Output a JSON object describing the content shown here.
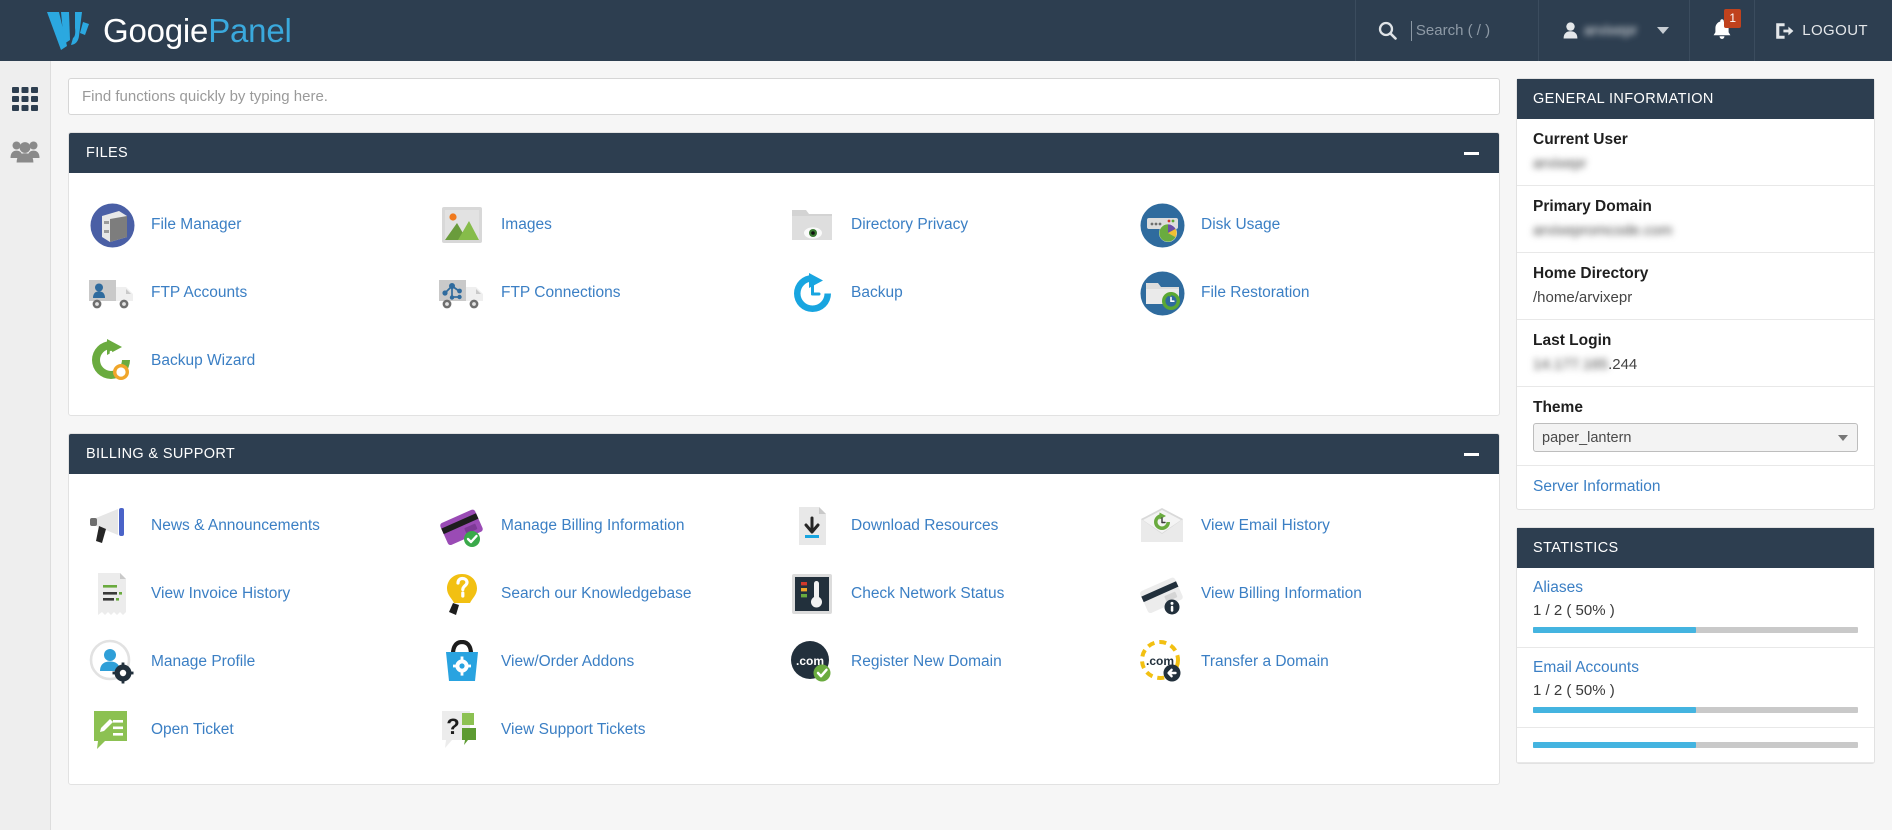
{
  "header": {
    "brand_primary": "Googie",
    "brand_secondary": "Panel",
    "search_placeholder": "Search ( / )",
    "search_value": "",
    "username": "arvixepr",
    "notification_count": "1",
    "logout_label": "LOGOUT",
    "bg_color": "#2d3e50"
  },
  "rail": {
    "items": [
      {
        "name": "apps-grid",
        "label": "Home"
      },
      {
        "name": "user-group",
        "label": "User Manager"
      }
    ]
  },
  "quick_search": {
    "placeholder": "Find functions quickly by typing here.",
    "value": ""
  },
  "panels": [
    {
      "id": "files",
      "title": "FILES",
      "collapse_label": "−",
      "items": [
        {
          "label": "File Manager",
          "icon": "file-manager-icon"
        },
        {
          "label": "Images",
          "icon": "images-icon"
        },
        {
          "label": "Directory Privacy",
          "icon": "directory-privacy-icon"
        },
        {
          "label": "Disk Usage",
          "icon": "disk-usage-icon"
        },
        {
          "label": "FTP Accounts",
          "icon": "ftp-accounts-icon"
        },
        {
          "label": "FTP Connections",
          "icon": "ftp-connections-icon"
        },
        {
          "label": "Backup",
          "icon": "backup-icon"
        },
        {
          "label": "File Restoration",
          "icon": "file-restoration-icon"
        },
        {
          "label": "Backup Wizard",
          "icon": "backup-wizard-icon"
        }
      ]
    },
    {
      "id": "billing-support",
      "title": "BILLING & SUPPORT",
      "collapse_label": "−",
      "items": [
        {
          "label": "News & Announcements",
          "icon": "megaphone-icon"
        },
        {
          "label": "Manage Billing Information",
          "icon": "credit-card-check-icon"
        },
        {
          "label": "Download Resources",
          "icon": "download-file-icon"
        },
        {
          "label": "View Email History",
          "icon": "email-history-icon"
        },
        {
          "label": "View Invoice History",
          "icon": "invoice-icon"
        },
        {
          "label": "Search our Knowledgebase",
          "icon": "lightbulb-question-icon"
        },
        {
          "label": "Check Network Status",
          "icon": "thermometer-icon"
        },
        {
          "label": "View Billing Information",
          "icon": "credit-card-info-icon"
        },
        {
          "label": "Manage Profile",
          "icon": "profile-gear-icon"
        },
        {
          "label": "View/Order Addons",
          "icon": "shopping-bag-gear-icon"
        },
        {
          "label": "Register New Domain",
          "icon": "domain-register-icon"
        },
        {
          "label": "Transfer a Domain",
          "icon": "domain-transfer-icon"
        },
        {
          "label": "Open Ticket",
          "icon": "open-ticket-icon"
        },
        {
          "label": "View Support Tickets",
          "icon": "support-tickets-icon"
        }
      ]
    }
  ],
  "general_information": {
    "title": "GENERAL INFORMATION",
    "rows": [
      {
        "label": "Current User",
        "value": "arvixepr",
        "redacted": true
      },
      {
        "label": "Primary Domain",
        "value": "arvixepromcode.com",
        "redacted": true
      },
      {
        "label": "Home Directory",
        "value": "/home/arvixepr",
        "redacted": false
      },
      {
        "label": "Last Login",
        "value_redacted": "14.177.165",
        "value_clear": ".244",
        "redacted": "partial"
      }
    ],
    "theme_label": "Theme",
    "theme_value": "paper_lantern",
    "server_information_link": "Server Information"
  },
  "statistics": {
    "title": "STATISTICS",
    "rows": [
      {
        "label": "Aliases",
        "value": "1 / 2 ( 50% )",
        "percent": 50
      },
      {
        "label": "Email Accounts",
        "value": "1 / 2 ( 50% )",
        "percent": 50
      },
      {
        "label": "",
        "value": "",
        "percent": 50
      }
    ],
    "bar_fill_color": "#44b4e0",
    "bar_track_color": "#c9c9c9"
  }
}
